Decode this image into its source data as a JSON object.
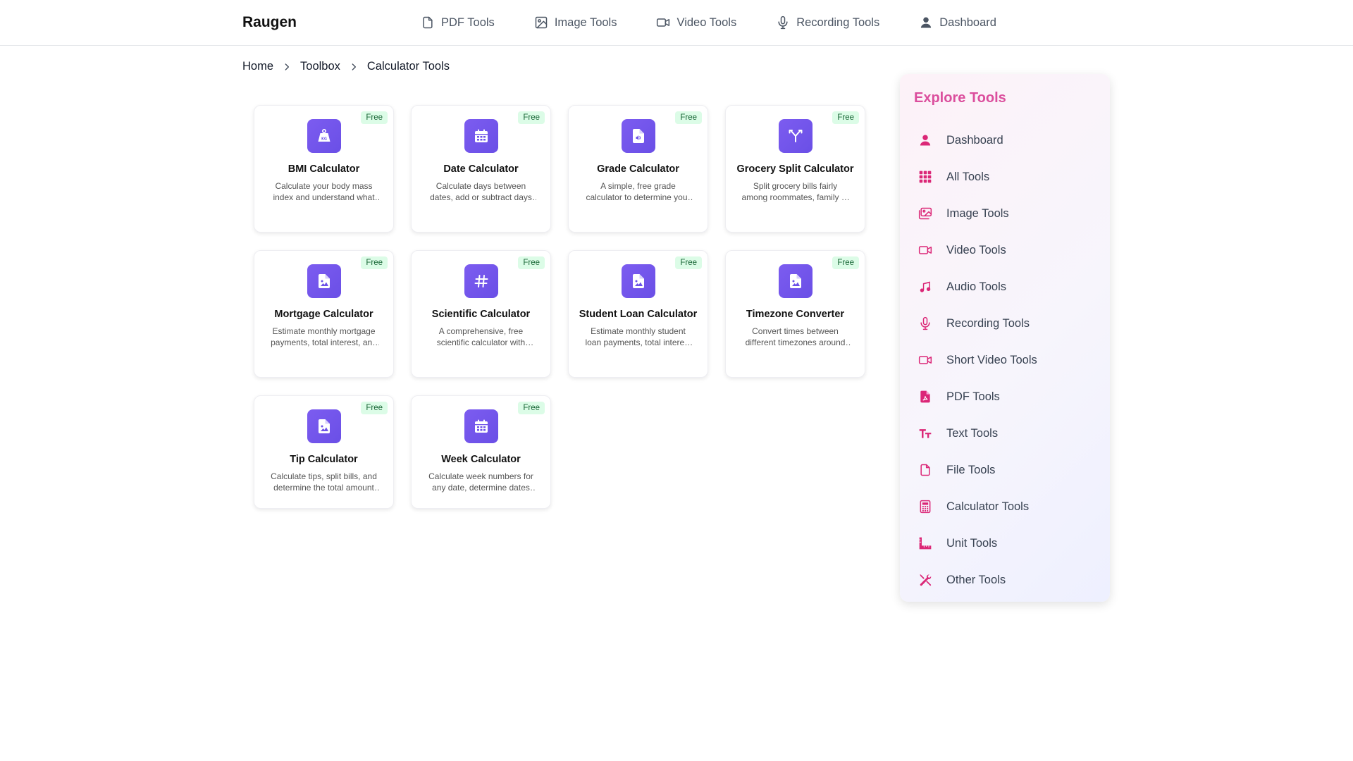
{
  "brand": {
    "name": "Raugen"
  },
  "nav": [
    {
      "label": "PDF Tools",
      "icon": "file-icon"
    },
    {
      "label": "Image Tools",
      "icon": "image-icon"
    },
    {
      "label": "Video Tools",
      "icon": "video-icon"
    },
    {
      "label": "Recording Tools",
      "icon": "microphone-icon"
    },
    {
      "label": "Dashboard",
      "icon": "user-icon"
    }
  ],
  "breadcrumb": [
    "Home",
    "Toolbox",
    "Calculator Tools"
  ],
  "badge_label": "Free",
  "tools": [
    {
      "title": "BMI Calculator",
      "desc": "Calculate your body mass index and understand what your result means for your health",
      "icon": "weight-icon"
    },
    {
      "title": "Date Calculator",
      "desc": "Calculate days between dates, add or subtract days from any date",
      "icon": "calendar-icon"
    },
    {
      "title": "Grade Calculator",
      "desc": "A simple, free grade calculator to determine your final grade",
      "icon": "file-audio-icon"
    },
    {
      "title": "Grocery Split Calculator",
      "desc": "Split grocery bills fairly among roommates, family or friends",
      "icon": "split-icon"
    },
    {
      "title": "Mortgage Calculator",
      "desc": "Estimate monthly mortgage payments, total interest, and amortization",
      "icon": "file-image-icon"
    },
    {
      "title": "Scientific Calculator",
      "desc": "A comprehensive, free scientific calculator with advanced functions",
      "icon": "hashtag-icon"
    },
    {
      "title": "Student Loan Calculator",
      "desc": "Estimate monthly student loan payments, total interest and payoff time",
      "icon": "file-image-icon"
    },
    {
      "title": "Timezone Converter",
      "desc": "Convert times between different timezones around the world",
      "icon": "file-image-icon"
    },
    {
      "title": "Tip Calculator",
      "desc": "Calculate tips, split bills, and determine the total amount per person",
      "icon": "file-image-icon"
    },
    {
      "title": "Week Calculator",
      "desc": "Calculate week numbers for any date, determine dates from week numbers",
      "icon": "calendar-icon"
    }
  ],
  "sidebar": {
    "title": "Explore Tools",
    "items": [
      {
        "label": "Dashboard",
        "icon": "user-icon"
      },
      {
        "label": "All Tools",
        "icon": "grid-icon"
      },
      {
        "label": "Image Tools",
        "icon": "images-icon"
      },
      {
        "label": "Video Tools",
        "icon": "video-icon"
      },
      {
        "label": "Audio Tools",
        "icon": "music-icon"
      },
      {
        "label": "Recording Tools",
        "icon": "microphone-icon"
      },
      {
        "label": "Short Video Tools",
        "icon": "video-icon"
      },
      {
        "label": "PDF Tools",
        "icon": "file-pdf-icon"
      },
      {
        "label": "Text Tools",
        "icon": "text-height-icon"
      },
      {
        "label": "File Tools",
        "icon": "file-icon"
      },
      {
        "label": "Calculator Tools",
        "icon": "calculator-icon"
      },
      {
        "label": "Unit Tools",
        "icon": "ruler-icon"
      },
      {
        "label": "Other Tools",
        "icon": "tools-icon"
      }
    ]
  },
  "colors": {
    "accent_purple": "#6d52e8",
    "accent_pink": "#db2777",
    "free_bg": "#dcfce7",
    "free_text": "#166534"
  }
}
